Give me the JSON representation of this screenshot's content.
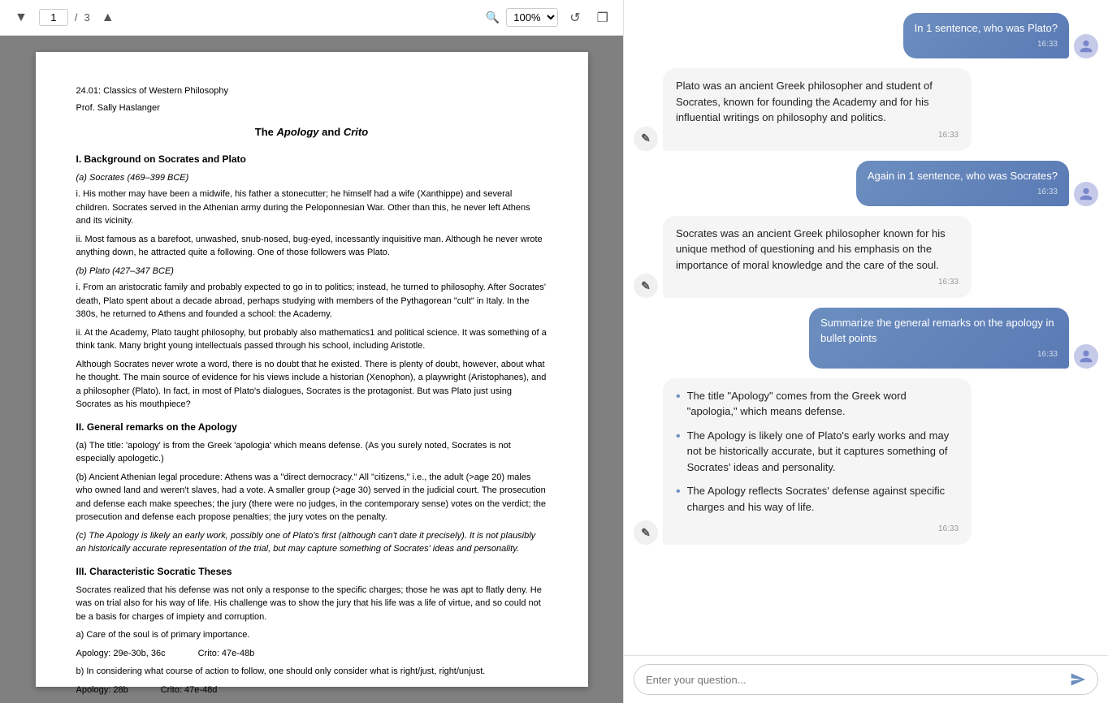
{
  "pdf_toolbar": {
    "prev_label": "◀",
    "next_label": "▶",
    "current_page": "1",
    "page_separator": "/",
    "total_pages": "3",
    "up_arrow": "▲",
    "search_icon": "🔍",
    "zoom_value": "100%",
    "zoom_dropdown": "▾",
    "refresh_icon": "↺",
    "fullscreen_icon": "⛶"
  },
  "pdf_content": {
    "course_line1": "24.01: Classics of Western Philosophy",
    "course_line2": "Prof. Sally Haslanger",
    "title_pre": "The ",
    "title_apology": "Apology",
    "title_and": " and ",
    "title_crito": "Crito",
    "section1_heading": "I.  Background on Socrates and Plato",
    "section1a_heading": "(a) Socrates (469–399 BCE)",
    "section1a_i": "i. His mother may have been a midwife, his father a stonecutter; he himself had a wife (Xanthippe) and several children. Socrates served in the Athenian army during the Peloponnesian War. Other than this, he never left Athens and its vicinity.",
    "section1a_ii": "ii. Most famous as a barefoot, unwashed, snub-nosed, bug-eyed, incessantly inquisitive man. Although he never wrote anything down, he attracted quite a following. One of those followers was Plato.",
    "section1b_heading": "(b) Plato (427–347 BCE)",
    "section1b_i": "i. From an aristocratic family and probably expected to go in to politics; instead, he turned to philosophy. After Socrates' death, Plato spent about a decade abroad, perhaps studying with members of the Pythagorean \"cult\" in Italy. In the 380s, he returned to Athens and founded a school: the Academy.",
    "section1b_ii": "ii. At the Academy, Plato taught philosophy, but probably also mathematics1 and political science. It was something of a think tank. Many bright young intellectuals passed through his school, including Aristotle.",
    "section1_para": "Although Socrates never wrote a word, there is no doubt that he existed.  There is plenty of doubt, however, about what he thought.  The main source of evidence for his views include a historian (Xenophon), a playwright (Aristophanes), and a philosopher (Plato).  In fact, in most of Plato's dialogues, Socrates is the protagonist.  But was Plato just using Socrates as his mouthpiece?",
    "section2_heading": "II.  General remarks on the Apology",
    "section2a_text": "(a) The title: 'apology' is from the Greek 'apologia' which means defense. (As you surely noted, Socrates is not especially apologetic.)",
    "section2b_text": "(b) Ancient Athenian legal procedure:  Athens was a \"direct democracy.\"  All \"citizens,\" i.e., the adult (>age 20) males who owned land and weren't slaves, had a vote.  A smaller group (>age 30) served in the judicial court. The prosecution and defense each make speeches; the jury (there were no judges, in the contemporary sense) votes on the verdict; the prosecution and defense each propose penalties; the jury votes on the penalty.",
    "section2c_text": "(c) The Apology is likely an early work, possibly one of Plato's first (although can't date it precisely).  It is not plausibly an historically accurate representation of the trial, but may capture something of Socrates' ideas and personality.",
    "section3_heading": "III. Characteristic Socratic Theses",
    "section3_para": "Socrates realized that his defense was not only a response to the specific charges; those he was apt to flatly deny. He was on trial also for his way of life.  His challenge was to show the jury that his life was a life of virtue, and so could not be a basis for charges of impiety and corruption.",
    "section3a_text": "a)  Care of the soul is of primary importance.",
    "section3a_ref1": "Apology: 29e-30b, 36c",
    "section3a_ref2": "Crito: 47e-48b",
    "section3b_text": "b)  In considering what course of action to follow, one should only consider what is right/just, right/unjust.",
    "section3b_ref1": "Apology: 28b",
    "section3b_ref2": "Crito: 47e-48d"
  },
  "chat": {
    "messages": [
      {
        "type": "user",
        "text": "In 1 sentence, who was Plato?",
        "time": "16:33"
      },
      {
        "type": "ai",
        "text": "Plato was an ancient Greek philosopher and student of Socrates, known for founding the Academy and for his influential writings on philosophy and politics.",
        "time": "16:33"
      },
      {
        "type": "user",
        "text": "Again in 1 sentence, who was Socrates?",
        "time": "16:33"
      },
      {
        "type": "ai",
        "text": "Socrates was an ancient Greek philosopher known for his unique method of questioning and his emphasis on the importance of moral knowledge and the care of the soul.",
        "time": "16:33"
      },
      {
        "type": "user",
        "text": "Summarize the general remarks on the apology in bullet points",
        "time": "16:33"
      },
      {
        "type": "ai_bullets",
        "bullets": [
          "The title \"Apology\" comes from the Greek word \"apologia,\" which means defense.",
          "The Apology is likely one of Plato's early works and may not be historically accurate, but it captures something of Socrates' ideas and personality.",
          "The Apology reflects Socrates' defense against specific charges and his way of life."
        ],
        "time": "16:33"
      }
    ],
    "input_placeholder": "Enter your question...",
    "send_icon": "send"
  }
}
